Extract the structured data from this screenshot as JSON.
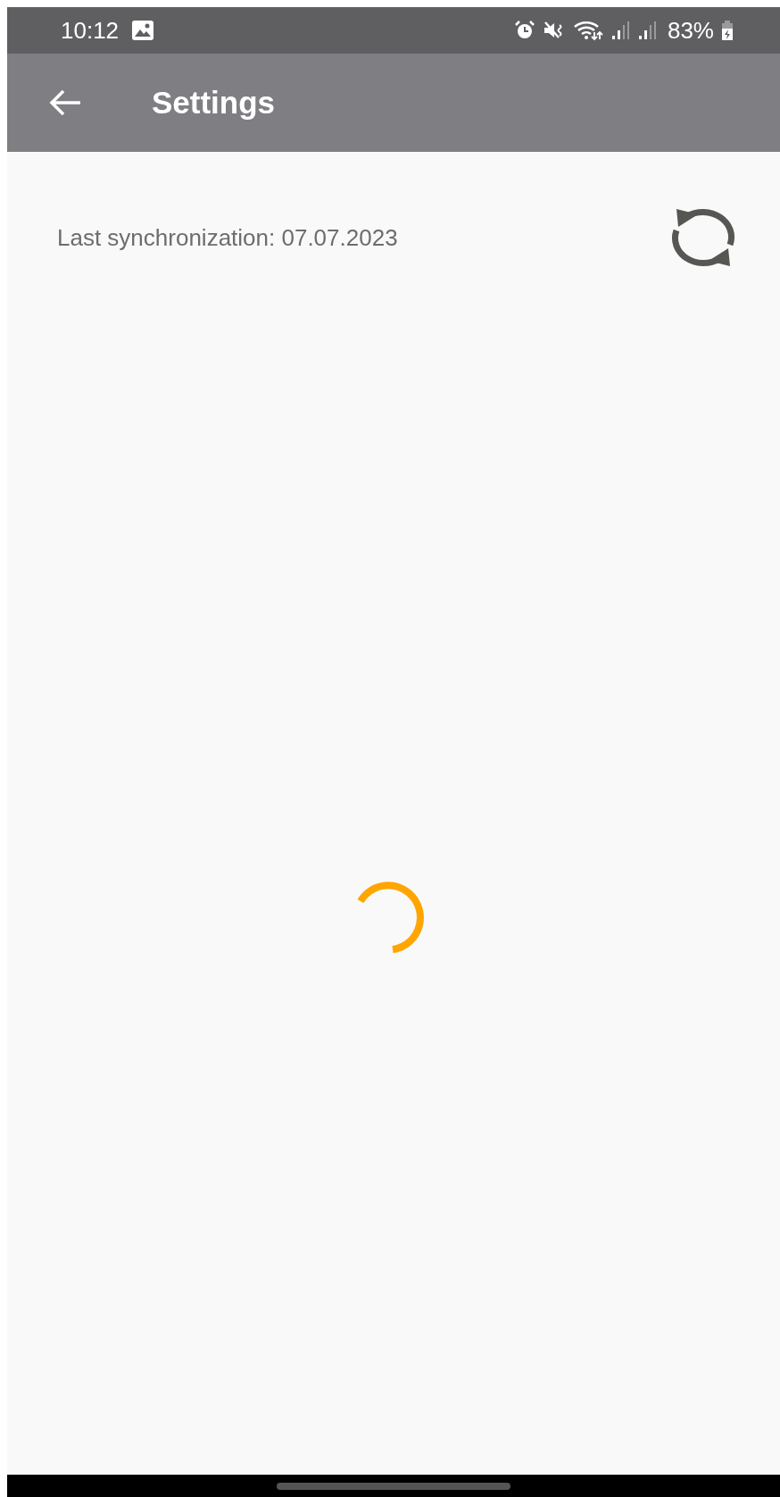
{
  "status_bar": {
    "time": "10:12",
    "battery_text": "83%"
  },
  "app_bar": {
    "title": "Settings"
  },
  "sync": {
    "label": "Last synchronization: 07.07.2023"
  }
}
